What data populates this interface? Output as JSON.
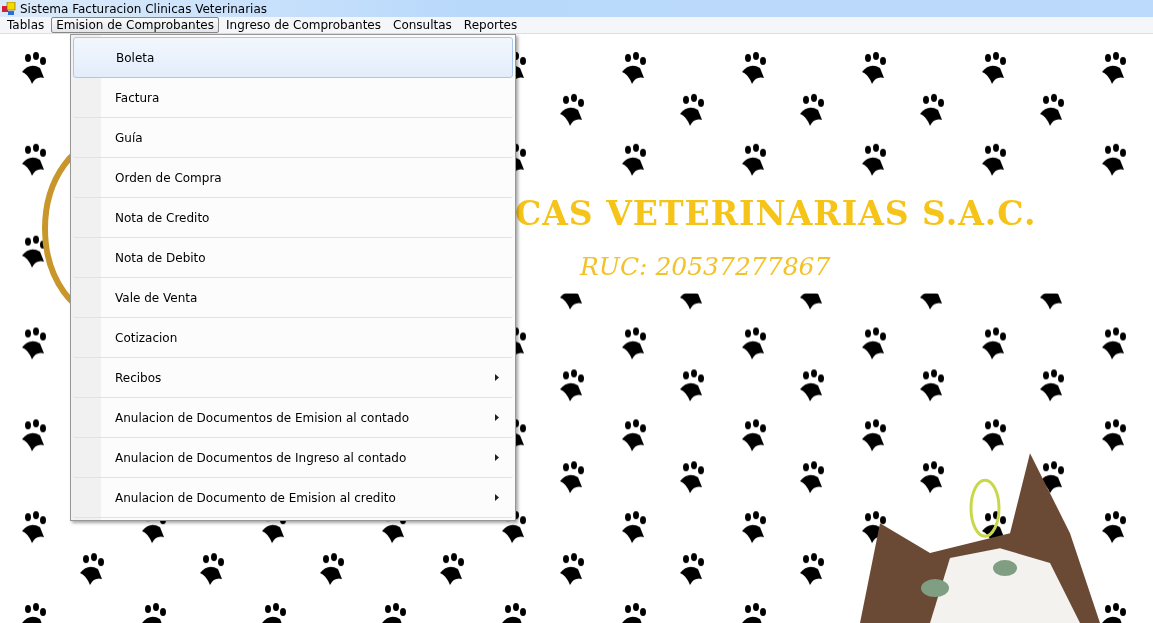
{
  "window": {
    "title": "Sistema Facturacion Clinicas  Veterinarias"
  },
  "menu_bar": [
    {
      "label": "Tablas",
      "selected": false
    },
    {
      "label": "Emision de Comprobantes",
      "selected": true
    },
    {
      "label": "Ingreso de Comprobantes",
      "selected": false
    },
    {
      "label": "Consultas",
      "selected": false
    },
    {
      "label": "Reportes",
      "selected": false
    }
  ],
  "dropdown": {
    "items": [
      {
        "label": "Boleta",
        "selected": true,
        "submenu": false
      },
      {
        "label": "Factura",
        "selected": false,
        "submenu": false
      },
      {
        "label": "Guía",
        "selected": false,
        "submenu": false
      },
      {
        "label": "Orden de Compra",
        "selected": false,
        "submenu": false
      },
      {
        "label": "Nota de Credito",
        "selected": false,
        "submenu": false
      },
      {
        "label": "Nota de Debito",
        "selected": false,
        "submenu": false
      },
      {
        "label": "Vale de Venta",
        "selected": false,
        "submenu": false
      },
      {
        "label": "Cotizacion",
        "selected": false,
        "submenu": false
      },
      {
        "label": "Recibos",
        "selected": false,
        "submenu": true
      },
      {
        "label": "Anulacion de Documentos de Emision al contado",
        "selected": false,
        "submenu": true
      },
      {
        "label": "Anulacion de Documentos de Ingreso al contado",
        "selected": false,
        "submenu": true
      },
      {
        "label": "Anulacion de Documento de Emision al credito",
        "selected": false,
        "submenu": true
      }
    ]
  },
  "banner": {
    "title": "CAS VETERINARIAS S.A.C.",
    "ruc": "RUC: 20537277867"
  }
}
